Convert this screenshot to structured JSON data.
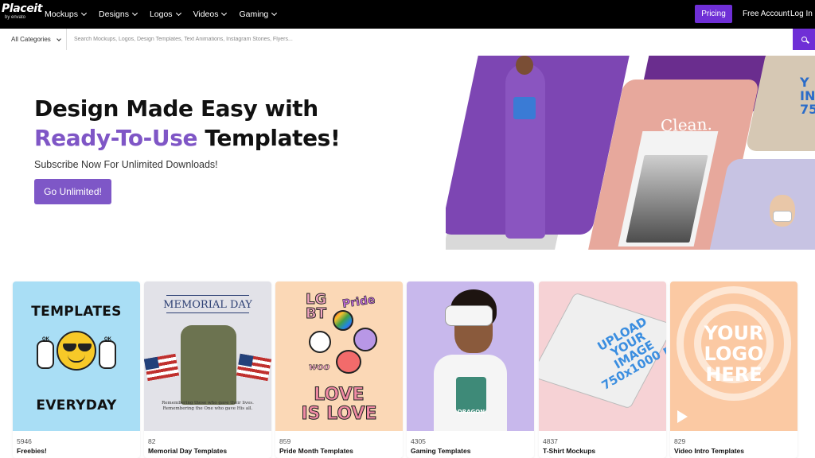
{
  "nav": {
    "logo": "Placeit",
    "logo_sub": "by envato",
    "items": [
      {
        "label": "Mockups"
      },
      {
        "label": "Designs"
      },
      {
        "label": "Logos"
      },
      {
        "label": "Videos"
      },
      {
        "label": "Gaming"
      }
    ],
    "pricing": "Pricing",
    "free_account": "Free Account",
    "login": "Log In"
  },
  "search": {
    "category": "All Categories",
    "placeholder": "Search Mockups, Logos, Design Templates, Text Animations, Instagram Stories, Flyers..."
  },
  "hero": {
    "title_line1": "Design Made Easy with",
    "title_accent": "Ready-To-Use",
    "title_rest": " Templates!",
    "subtitle": "Subscribe Now For Unlimited Downloads!",
    "cta": "Go Unlimited!",
    "art_text_clean": "Clean.",
    "art_text_right": "Y\nIN\n750",
    "accent_color": "#7f56c6"
  },
  "categories": [
    {
      "count": "5946",
      "label": "Freebies!",
      "bg": "#a9def5",
      "art_top": "TEMPLATES",
      "art_bottom": "EVERYDAY",
      "art_ok": "OK"
    },
    {
      "count": "82",
      "label": "Memorial Day Templates",
      "bg": "#e2e2e8",
      "art_title": "MEMORIAL DAY",
      "art_foot": "Remembering those who gave their lives.\nRemembering the One who gave His all."
    },
    {
      "count": "859",
      "label": "Pride Month Templates",
      "bg": "#fbd8b6",
      "art_love": "LOVE\nIS LOVE",
      "art_lgbt": "LG\nBT",
      "art_pride": "Pride",
      "art_woo": "woo"
    },
    {
      "count": "4305",
      "label": "Gaming Templates",
      "bg": "#c8b8ec",
      "art_shirt": "DRAGON"
    },
    {
      "count": "4837",
      "label": "T-Shirt Mockups",
      "bg": "#f6d2d5",
      "art_text": "UPLOAD\nYOUR\nIMAGE\n750x1000 px"
    },
    {
      "count": "829",
      "label": "Video Intro Templates",
      "bg": "#fbc9a3",
      "art_text": "YOUR\nLOGO\nHERE"
    }
  ]
}
